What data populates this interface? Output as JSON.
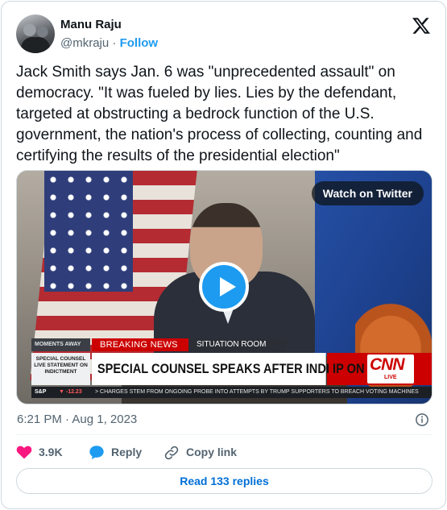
{
  "author": {
    "name": "Manu Raju",
    "handle": "@mkraju",
    "separator": "·",
    "follow_label": "Follow"
  },
  "tweet": {
    "text": "Jack Smith says Jan. 6 was \"unprecedented assault\" on democracy. \"It was fueled by lies. Lies by the defendant, targeted at obstructing a bedrock function of the U.S. government, the nation's process of collecting, counting and certifying the results of the presidential election\"",
    "timestamp": "6:21 PM · Aug 1, 2023"
  },
  "media": {
    "watch_label": "Watch on Twitter",
    "chyron": {
      "moments": "MOMENTS AWAY",
      "breaking": "BREAKING NEWS",
      "section": "SITUATION ROOM",
      "live_box": "SPECIAL COUNSEL LIVE STATEMENT ON INDICTMENT",
      "headline": "SPECIAL COUNSEL SPEAKS AFTER INDI    IP ON",
      "network": "CNN",
      "network_live": "LIVE",
      "ticker_index": "S&P",
      "ticker_value": "▼ -12.23",
      "ticker_text": "> CHARGES STEM FROM ONGOING PROBE INTO ATTEMPTS BY TRUMP SUPPORTERS TO BREACH VOTING MACHINES"
    }
  },
  "actions": {
    "likes": "3.9K",
    "reply_label": "Reply",
    "copy_label": "Copy link",
    "read_replies_label": "Read 133 replies"
  },
  "colors": {
    "accent": "#1d9bf0",
    "like": "#f91880",
    "text_secondary": "#536471"
  }
}
